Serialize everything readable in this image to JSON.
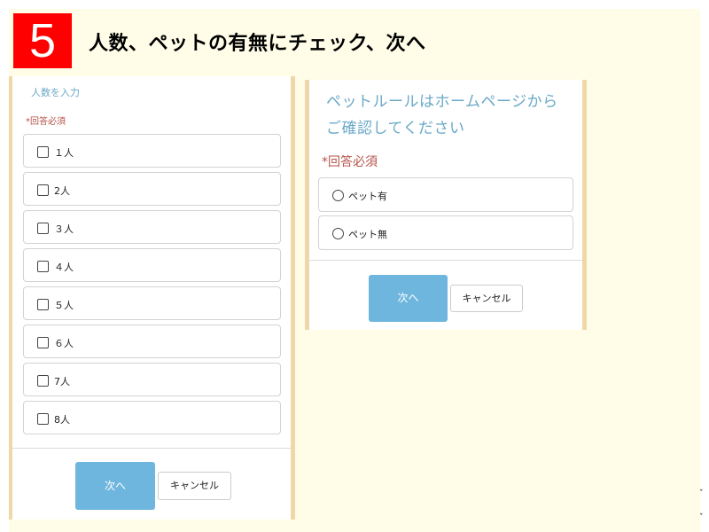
{
  "heading": {
    "step_number": "5",
    "title": "人数、ペットの有無にチェック、次へ"
  },
  "left_panel": {
    "instruction": "人数を入力",
    "required_label": "*回答必須",
    "options": [
      {
        "label": "１人",
        "checked": false
      },
      {
        "label": "2人",
        "checked": false
      },
      {
        "label": "３人",
        "checked": false
      },
      {
        "label": "４人",
        "checked": false
      },
      {
        "label": "５人",
        "checked": false
      },
      {
        "label": "６人",
        "checked": false
      },
      {
        "label": "7人",
        "checked": false
      },
      {
        "label": "8人",
        "checked": false
      }
    ],
    "next_label": "次へ",
    "cancel_label": "キャンセル"
  },
  "right_panel": {
    "instruction_line1": "ペットルールはホームページから",
    "instruction_line2": "ご確認してください",
    "required_label": "*回答必須",
    "options": [
      {
        "label": "ペット有",
        "selected": false
      },
      {
        "label": "ペット無",
        "selected": false
      }
    ],
    "next_label": "次へ",
    "cancel_label": "キャンセル"
  },
  "colors": {
    "step_badge": "#ff0000",
    "accent_blue": "#6fb6de",
    "required_red": "#b5524a",
    "panel_frame": "#f0d7a8",
    "slide_background": "#fffde8"
  },
  "icons": {
    "checkbox": "checkbox-icon",
    "radio": "radio-icon"
  }
}
